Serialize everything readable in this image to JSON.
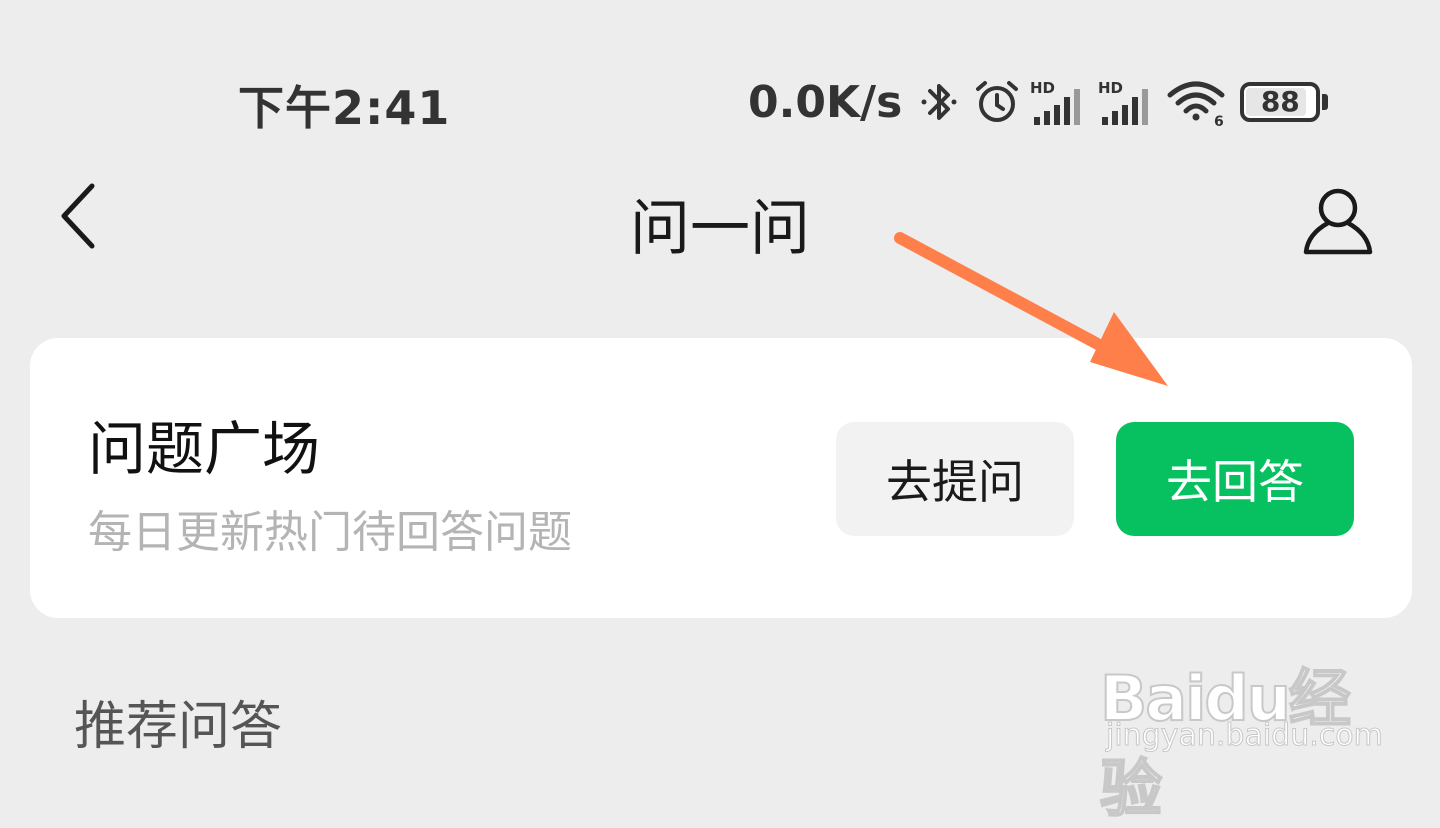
{
  "status_bar": {
    "time": "下午2:41",
    "net_speed": "0.0K/s",
    "battery_level": "88",
    "icons": [
      "bluetooth-icon",
      "alarm-icon",
      "signal-hd-icon",
      "signal-hd-icon",
      "wifi-6-icon",
      "battery-icon"
    ]
  },
  "nav": {
    "title": "问一问",
    "back_icon": "chevron-left-icon",
    "profile_icon": "person-icon"
  },
  "card": {
    "title": "问题广场",
    "subtitle": "每日更新热门待回答问题",
    "ask_button": "去提问",
    "answer_button": "去回答"
  },
  "section": {
    "title": "推荐问答"
  },
  "watermark": {
    "logo": "Baidu经验",
    "url": "jingyan.baidu.com"
  },
  "colors": {
    "background": "#ededed",
    "card": "#ffffff",
    "primary_green": "#07c160",
    "annotation_arrow": "#ff7f4a"
  }
}
